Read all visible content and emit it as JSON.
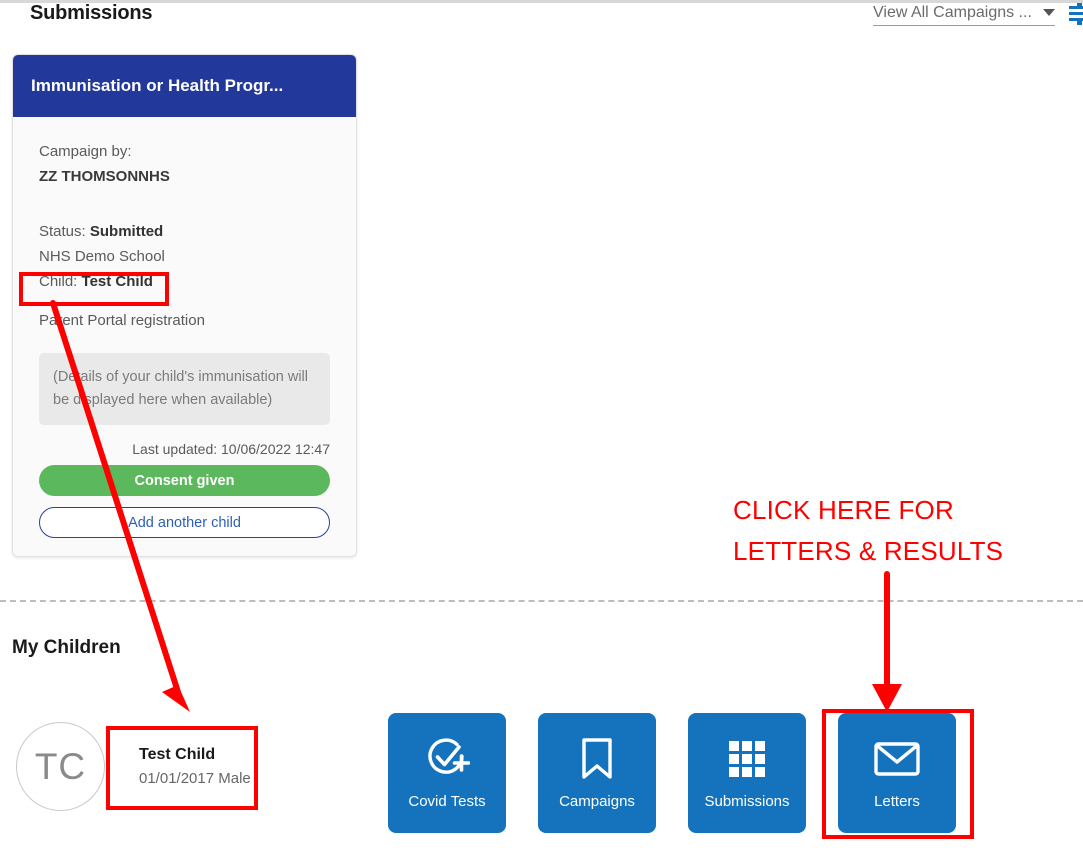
{
  "header": {
    "page_title": "Submissions",
    "campaign_filter_label": "View All Campaigns ...",
    "caret_icon": "chevron-down-icon",
    "edge_icon": "menu-collapse-icon"
  },
  "submission_card": {
    "title": "Immunisation or Health Progr...",
    "campaign_by_label": "Campaign by:",
    "campaign_by_value": "ZZ THOMSONNHS",
    "status_label": "Status:",
    "status_value": "Submitted",
    "school": "NHS Demo School",
    "child_label": "Child:",
    "child_value": "Test Child",
    "registration": "Parent Portal registration",
    "details_placeholder": "(Details of your child's immunisation will be displayed here when available)",
    "last_updated": "Last updated: 10/06/2022 12:47",
    "consent_button": "Consent given",
    "add_child_button": "Add another child"
  },
  "children_section": {
    "heading": "My Children",
    "children": [
      {
        "initials": "TC",
        "name": "Test Child",
        "dob_gender": "01/01/2017 Male"
      }
    ]
  },
  "tiles": [
    {
      "label": "Covid Tests",
      "icon": "covid-test-check-plus-icon"
    },
    {
      "label": "Campaigns",
      "icon": "bookmark-icon"
    },
    {
      "label": "Submissions",
      "icon": "grid-icon"
    },
    {
      "label": "Letters",
      "icon": "envelope-icon"
    }
  ],
  "annotations": {
    "callout_line1": "CLICK HERE FOR",
    "callout_line2": "LETTERS & RESULTS",
    "highlight_color": "#ff0000"
  },
  "colors": {
    "card_header_navy": "#22389a",
    "tile_blue": "#1573be",
    "consent_green": "#5cb85c",
    "annotation_red": "#ff0000"
  }
}
